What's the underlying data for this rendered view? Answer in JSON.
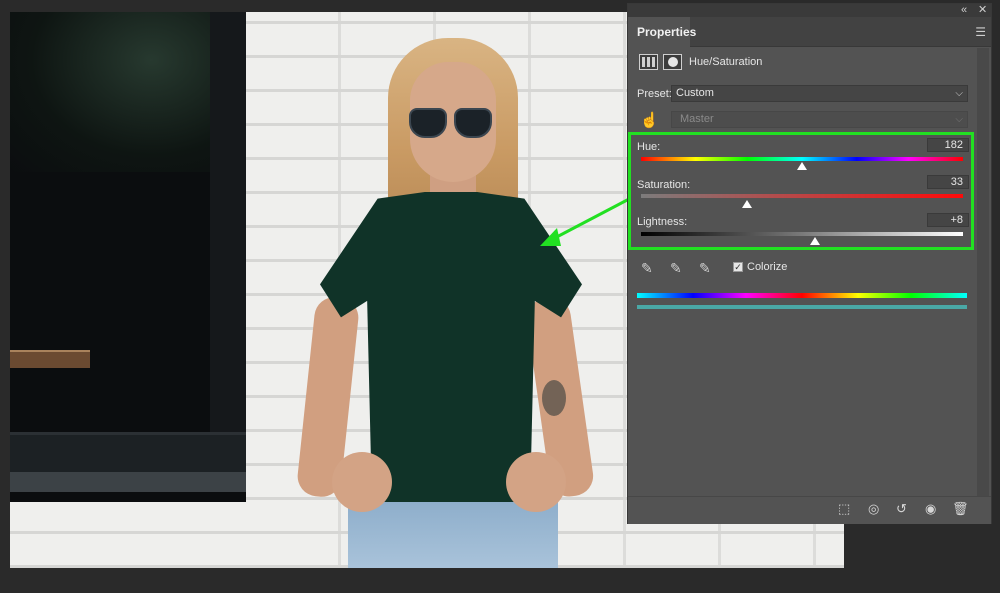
{
  "panel": {
    "tab_label": "Properties",
    "adjustment_title": "Hue/Saturation",
    "preset": {
      "label": "Preset:",
      "value": "Custom"
    },
    "channel": {
      "value": "Master"
    },
    "sliders": {
      "hue": {
        "label": "Hue:",
        "value": "182",
        "fraction": 0.5
      },
      "saturation": {
        "label": "Saturation:",
        "value": "33",
        "fraction": 0.33
      },
      "lightness": {
        "label": "Lightness:",
        "value": "+8",
        "fraction": 0.54
      }
    },
    "colorize": {
      "label": "Colorize",
      "checked": true
    }
  },
  "colors": {
    "highlight": "#22e022",
    "panel_bg": "#535353",
    "shirt": "#103328"
  },
  "icons": [
    "collapse-icon",
    "close-icon",
    "panel-menu-icon",
    "adjustment-layer-icon",
    "mask-icon",
    "targeted-adjust-hand-icon",
    "eyedropper-icon",
    "eyedropper-plus-icon",
    "eyedropper-minus-icon",
    "clip-to-layer-icon",
    "view-previous-icon",
    "reset-icon",
    "visibility-icon",
    "delete-icon"
  ]
}
